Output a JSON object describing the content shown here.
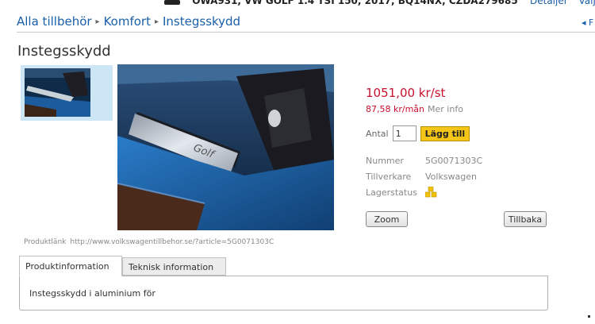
{
  "vehicle": {
    "info": "OWA931, VW GOLF 1.4 TSI 150, 2017, BQ14NX, CZDA279685",
    "links": [
      "Detaljer",
      "Välj Anna"
    ]
  },
  "breadcrumb": {
    "items": [
      "Alla tillbehör",
      "Komfort",
      "Instegsskydd"
    ],
    "next_link": "F"
  },
  "product": {
    "title": "Instegsskydd",
    "price": "1051,00 kr/st",
    "monthly_price": "87,58 kr/mån",
    "more_info": "Mer info",
    "quantity_label": "Antal",
    "quantity_value": "1",
    "add_button": "Lägg till",
    "specs": {
      "number_label": "Nummer",
      "number_value": "5G0071303C",
      "manufacturer_label": "Tillverkare",
      "manufacturer_value": "Volkswagen",
      "stock_label": "Lagerstatus"
    },
    "zoom_button": "Zoom",
    "back_button": "Tillbaka",
    "link_label": "Produktlänk",
    "link_url": "http://www.volkswagentillbehor.se/?article=5G0071303C"
  },
  "tabs": {
    "items": [
      "Produktinformation",
      "Teknisk information"
    ],
    "active_content": "Instegsskydd i aluminium för"
  },
  "colors": {
    "link": "#1a5fa8",
    "price": "#c8102e",
    "add_button": "#f5c518",
    "thumb_bg": "#cde6f5"
  },
  "icons": {
    "vehicle": "car-icon",
    "stock": "stock-status-icon"
  }
}
